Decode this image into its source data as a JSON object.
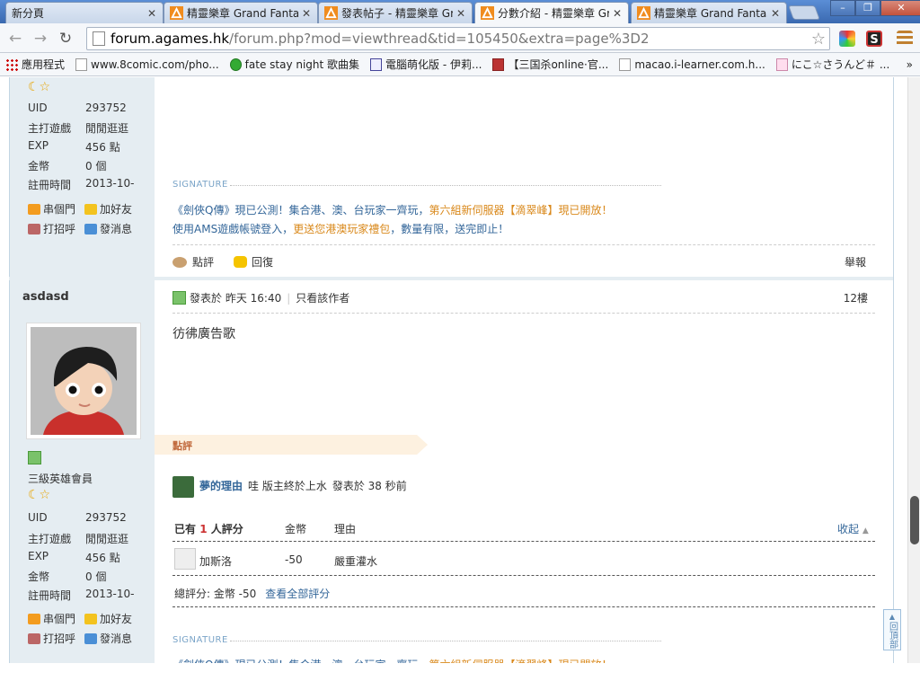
{
  "tabs": [
    {
      "title": "新分頁",
      "active": false
    },
    {
      "title": "精靈樂章 Grand Fantasia",
      "active": false
    },
    {
      "title": "發表帖子 - 精靈樂章 Grand",
      "active": false
    },
    {
      "title": "分數介紹 - 精靈樂章 Grand",
      "active": true
    },
    {
      "title": "精靈樂章 Grand Fantasia",
      "active": false
    }
  ],
  "toolbar": {
    "url_host": "forum.agames.hk",
    "url_rest": "/forum.php?mod=viewthread&tid=105450&extra=page%3D2"
  },
  "bookmarks": [
    "應用程式",
    "www.8comic.com/pho...",
    "fate stay night 歌曲集",
    "電腦萌化版 - 伊莉...",
    "【三国杀online·官...",
    "macao.i-learner.com.h...",
    "にこ☆さうんど＃ ...",
    "»"
  ],
  "top_user": {
    "stats": [
      {
        "k": "UID",
        "v": "293752"
      },
      {
        "k": "主打遊戲",
        "v": "閒閒逛逛"
      },
      {
        "k": "EXP",
        "v": "456 點"
      },
      {
        "k": "金幣",
        "v": "0 個"
      },
      {
        "k": "註冊時間",
        "v": "2013-10-"
      }
    ],
    "actions": [
      "串個門",
      "加好友",
      "打招呼",
      "發消息"
    ]
  },
  "signature": {
    "label": "SIGNATURE",
    "line1a": "《劍俠Q傳》現已公測！集合港、澳、台玩家一齊玩，",
    "line1b": "第六組新伺服器【滴翠峰】現已開放！",
    "line2a": "使用AMS遊戲帳號登入，",
    "line2b": "更送您港澳玩家禮包",
    "line2c": "，數量有限，送完即止！"
  },
  "post_actions": {
    "rate": "點評",
    "reply": "回復",
    "report": "舉報"
  },
  "post": {
    "author": "asdasd",
    "group": "三級英雄會員",
    "meta_posted": "發表於 昨天 16:40",
    "only_author": "只看該作者",
    "floor": "12樓",
    "content": "彷彿廣告歌",
    "stats": [
      {
        "k": "UID",
        "v": "293752"
      },
      {
        "k": "主打遊戲",
        "v": "閒閒逛逛"
      },
      {
        "k": "EXP",
        "v": "456 點"
      },
      {
        "k": "金幣",
        "v": "0 個"
      },
      {
        "k": "註冊時間",
        "v": "2013-10-"
      }
    ],
    "actions": [
      "串個門",
      "加好友",
      "打招呼",
      "發消息"
    ]
  },
  "comment_block": {
    "title": "點評",
    "commenter": "夢的理由",
    "comment_text": "哇 版主終於上水",
    "comment_time": "發表於 38 秒前"
  },
  "rating": {
    "prefix": "已有",
    "count": "1",
    "suffix": "人評分",
    "col_coin": "金幣",
    "col_reason": "理由",
    "collapse": "收起",
    "row": {
      "user": "加斯洛",
      "coin": "-50",
      "reason": "嚴重灌水"
    },
    "total": "總評分: 金幣 -50",
    "view_all": "查看全部評分"
  },
  "back_to_top": "回頂部"
}
